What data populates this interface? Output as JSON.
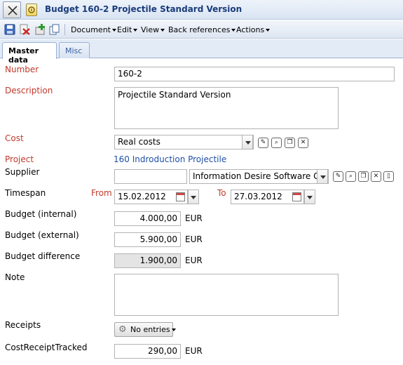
{
  "window": {
    "title": "Budget 160-2 Projectile Standard Version"
  },
  "toolbar": {
    "icons": [
      "save-icon",
      "delete-icon",
      "add-icon",
      "copy-icon"
    ],
    "menus": [
      "Document",
      "Edit",
      "View",
      "Back references",
      "Actions"
    ]
  },
  "tabs": [
    {
      "label": "Master data",
      "active": true
    },
    {
      "label": "Misc",
      "active": false
    }
  ],
  "form": {
    "number": {
      "label": "Number",
      "value": "160-2"
    },
    "description": {
      "label": "Description",
      "value": "Projectile Standard Version"
    },
    "cost": {
      "label": "Cost",
      "value": "Real costs"
    },
    "project": {
      "label": "Project",
      "value": "160 Indroduction Projectile"
    },
    "supplier": {
      "label": "Supplier",
      "value": "",
      "company": "Information Desire Software Gmb"
    },
    "timespan": {
      "label": "Timespan",
      "from_label": "From",
      "from": "15.02.2012",
      "to_label": "To",
      "to": "27.03.2012"
    },
    "budget_internal": {
      "label": "Budget (internal)",
      "value": "4.000,00",
      "unit": "EUR"
    },
    "budget_external": {
      "label": "Budget (external)",
      "value": "5.900,00",
      "unit": "EUR"
    },
    "budget_difference": {
      "label": "Budget difference",
      "value": "1.900,00",
      "unit": "EUR"
    },
    "note": {
      "label": "Note",
      "value": ""
    },
    "receipts": {
      "label": "Receipts",
      "button": "No entries"
    },
    "cost_receipt_tracked": {
      "label": "CostReceiptTracked",
      "value": "290,00",
      "unit": "EUR"
    }
  },
  "colors": {
    "required_label": "#c0392b",
    "link": "#1f4fa8",
    "title": "#1a3c7a"
  }
}
